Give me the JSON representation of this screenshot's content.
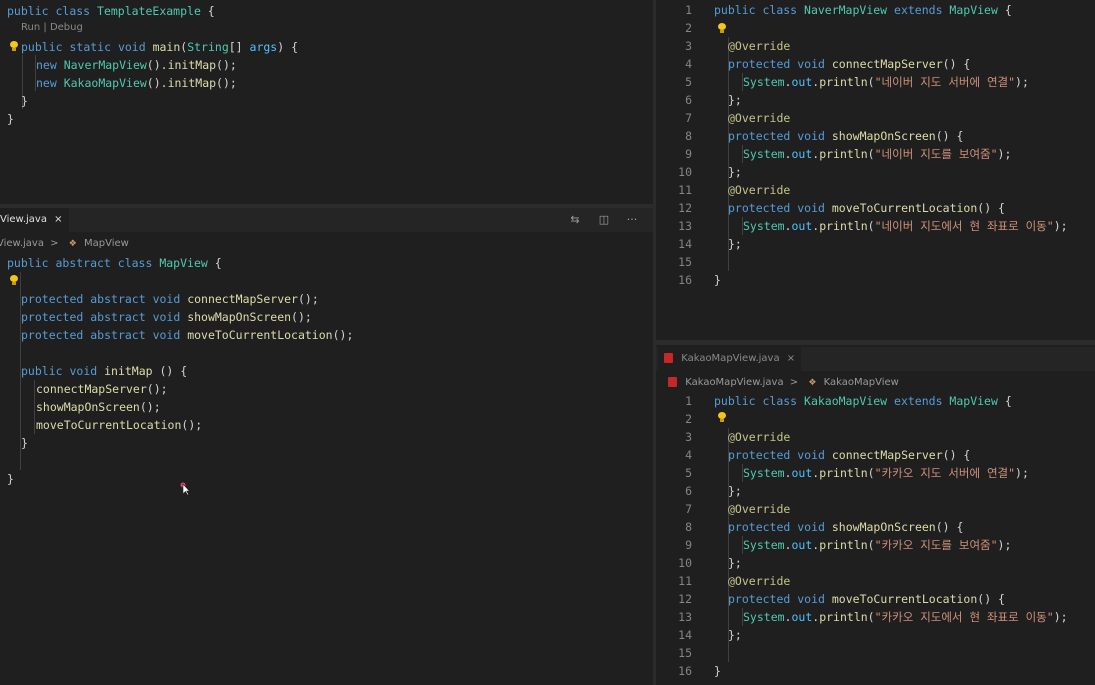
{
  "panes": {
    "top_left": {
      "codelens": {
        "run": "Run",
        "separator": "|",
        "debug": "Debug"
      },
      "lines": [
        [
          [
            "kw",
            "public "
          ],
          [
            "kw",
            "class "
          ],
          [
            "cls",
            "TemplateExample "
          ],
          [
            "plain",
            "{"
          ]
        ],
        [
          [
            "kw",
            "public "
          ],
          [
            "kw",
            "static "
          ],
          [
            "kw",
            "void "
          ],
          [
            "fn",
            "main"
          ],
          [
            "plain",
            "("
          ],
          [
            "cls",
            "String"
          ],
          [
            "plain",
            "[] "
          ],
          [
            "field",
            "args"
          ],
          [
            "plain",
            ") {"
          ]
        ],
        [
          [
            "kw",
            "new "
          ],
          [
            "cls",
            "NaverMapView"
          ],
          [
            "plain",
            "()."
          ],
          [
            "fn",
            "initMap"
          ],
          [
            "plain",
            "();"
          ]
        ],
        [
          [
            "kw",
            "new "
          ],
          [
            "cls",
            "KakaoMapView"
          ],
          [
            "plain",
            "()."
          ],
          [
            "fn",
            "initMap"
          ],
          [
            "plain",
            "();"
          ]
        ],
        [
          [
            "plain",
            "}"
          ]
        ],
        [
          [
            "plain",
            "}"
          ]
        ]
      ]
    },
    "bottom_left": {
      "tab": {
        "label": "View.java",
        "close": "×"
      },
      "breadcrumb": {
        "file": "View.java",
        "separator": ">",
        "symbol": "MapView"
      },
      "toolbar": {
        "compare": "⇆",
        "split": "◫",
        "more": "···"
      },
      "lines": [
        [
          [
            "kw",
            "public "
          ],
          [
            "kw",
            "abstract "
          ],
          [
            "kw",
            "class "
          ],
          [
            "cls",
            "MapView "
          ],
          [
            "plain",
            "{"
          ]
        ],
        [],
        [
          [
            "kw",
            "protected "
          ],
          [
            "kw",
            "abstract "
          ],
          [
            "kw",
            "void "
          ],
          [
            "fn",
            "connectMapServer"
          ],
          [
            "plain",
            "();"
          ]
        ],
        [
          [
            "kw",
            "protected "
          ],
          [
            "kw",
            "abstract "
          ],
          [
            "kw",
            "void "
          ],
          [
            "fn",
            "showMapOnScreen"
          ],
          [
            "plain",
            "();"
          ]
        ],
        [
          [
            "kw",
            "protected "
          ],
          [
            "kw",
            "abstract "
          ],
          [
            "kw",
            "void "
          ],
          [
            "fn",
            "moveToCurrentLocation"
          ],
          [
            "plain",
            "();"
          ]
        ],
        [],
        [
          [
            "kw",
            "public "
          ],
          [
            "kw",
            "void "
          ],
          [
            "fn",
            "initMap "
          ],
          [
            "plain",
            "() {"
          ]
        ],
        [
          [
            "fn",
            "connectMapServer"
          ],
          [
            "plain",
            "();"
          ]
        ],
        [
          [
            "fn",
            "showMapOnScreen"
          ],
          [
            "plain",
            "();"
          ]
        ],
        [
          [
            "fn",
            "moveToCurrentLocation"
          ],
          [
            "plain",
            "();"
          ]
        ],
        [
          [
            "plain",
            "}"
          ]
        ],
        [],
        [
          [
            "plain",
            "}"
          ]
        ]
      ]
    },
    "top_right": {
      "line_numbers": [
        "1",
        "2",
        "3",
        "4",
        "5",
        "6",
        "7",
        "8",
        "9",
        "10",
        "11",
        "12",
        "13",
        "14",
        "15",
        "16"
      ],
      "lines": [
        [
          [
            "kw",
            "public "
          ],
          [
            "kw",
            "class "
          ],
          [
            "cls",
            "NaverMapView "
          ],
          [
            "kw",
            "extends "
          ],
          [
            "cls",
            "MapView "
          ],
          [
            "plain",
            "{"
          ]
        ],
        [],
        [
          [
            "ann",
            "@Override"
          ]
        ],
        [
          [
            "kw",
            "protected "
          ],
          [
            "kw",
            "void "
          ],
          [
            "fn",
            "connectMapServer"
          ],
          [
            "plain",
            "() {"
          ]
        ],
        [
          [
            "cls",
            "System"
          ],
          [
            "plain",
            "."
          ],
          [
            "field",
            "out"
          ],
          [
            "plain",
            "."
          ],
          [
            "fn",
            "println"
          ],
          [
            "plain",
            "("
          ],
          [
            "str",
            "\"네이버 지도 서버에 연결\""
          ],
          [
            "plain",
            ");"
          ]
        ],
        [
          [
            "plain",
            "};"
          ]
        ],
        [
          [
            "ann",
            "@Override"
          ]
        ],
        [
          [
            "kw",
            "protected "
          ],
          [
            "kw",
            "void "
          ],
          [
            "fn",
            "showMapOnScreen"
          ],
          [
            "plain",
            "() {"
          ]
        ],
        [
          [
            "cls",
            "System"
          ],
          [
            "plain",
            "."
          ],
          [
            "field",
            "out"
          ],
          [
            "plain",
            "."
          ],
          [
            "fn",
            "println"
          ],
          [
            "plain",
            "("
          ],
          [
            "str",
            "\"네이버 지도를 보여줌\""
          ],
          [
            "plain",
            ");"
          ]
        ],
        [
          [
            "plain",
            "};"
          ]
        ],
        [
          [
            "ann",
            "@Override"
          ]
        ],
        [
          [
            "kw",
            "protected "
          ],
          [
            "kw",
            "void "
          ],
          [
            "fn",
            "moveToCurrentLocation"
          ],
          [
            "plain",
            "() {"
          ]
        ],
        [
          [
            "cls",
            "System"
          ],
          [
            "plain",
            "."
          ],
          [
            "field",
            "out"
          ],
          [
            "plain",
            "."
          ],
          [
            "fn",
            "println"
          ],
          [
            "plain",
            "("
          ],
          [
            "str",
            "\"네이버 지도에서 현 좌표로 이동\""
          ],
          [
            "plain",
            ");"
          ]
        ],
        [
          [
            "plain",
            "};"
          ]
        ],
        [],
        [
          [
            "plain",
            "}"
          ]
        ]
      ]
    },
    "bottom_right": {
      "tab": {
        "label": "KakaoMapView.java",
        "close": "×"
      },
      "breadcrumb": {
        "file": "KakaoMapView.java",
        "separator": ">",
        "symbol": "KakaoMapView"
      },
      "line_numbers": [
        "1",
        "2",
        "3",
        "4",
        "5",
        "6",
        "7",
        "8",
        "9",
        "10",
        "11",
        "12",
        "13",
        "14",
        "15",
        "16"
      ],
      "lines": [
        [
          [
            "kw",
            "public "
          ],
          [
            "kw",
            "class "
          ],
          [
            "cls",
            "KakaoMapView "
          ],
          [
            "kw",
            "extends "
          ],
          [
            "cls",
            "MapView "
          ],
          [
            "plain",
            "{"
          ]
        ],
        [],
        [
          [
            "ann",
            "@Override"
          ]
        ],
        [
          [
            "kw",
            "protected "
          ],
          [
            "kw",
            "void "
          ],
          [
            "fn",
            "connectMapServer"
          ],
          [
            "plain",
            "() {"
          ]
        ],
        [
          [
            "cls",
            "System"
          ],
          [
            "plain",
            "."
          ],
          [
            "field",
            "out"
          ],
          [
            "plain",
            "."
          ],
          [
            "fn",
            "println"
          ],
          [
            "plain",
            "("
          ],
          [
            "str",
            "\"카카오 지도 서버에 연결\""
          ],
          [
            "plain",
            ");"
          ]
        ],
        [
          [
            "plain",
            "};"
          ]
        ],
        [
          [
            "ann",
            "@Override"
          ]
        ],
        [
          [
            "kw",
            "protected "
          ],
          [
            "kw",
            "void "
          ],
          [
            "fn",
            "showMapOnScreen"
          ],
          [
            "plain",
            "() {"
          ]
        ],
        [
          [
            "cls",
            "System"
          ],
          [
            "plain",
            "."
          ],
          [
            "field",
            "out"
          ],
          [
            "plain",
            "."
          ],
          [
            "fn",
            "println"
          ],
          [
            "plain",
            "("
          ],
          [
            "str",
            "\"카카오 지도를 보여줌\""
          ],
          [
            "plain",
            ");"
          ]
        ],
        [
          [
            "plain",
            "};"
          ]
        ],
        [
          [
            "ann",
            "@Override"
          ]
        ],
        [
          [
            "kw",
            "protected "
          ],
          [
            "kw",
            "void "
          ],
          [
            "fn",
            "moveToCurrentLocation"
          ],
          [
            "plain",
            "() {"
          ]
        ],
        [
          [
            "cls",
            "System"
          ],
          [
            "plain",
            "."
          ],
          [
            "field",
            "out"
          ],
          [
            "plain",
            "."
          ],
          [
            "fn",
            "println"
          ],
          [
            "plain",
            "("
          ],
          [
            "str",
            "\"카카오 지도에서 현 좌표로 이동\""
          ],
          [
            "plain",
            ");"
          ]
        ],
        [
          [
            "plain",
            "};"
          ]
        ],
        [],
        [
          [
            "plain",
            "}"
          ]
        ]
      ]
    }
  },
  "colors": {
    "background": "#1f1f1f",
    "keyword": "#569cd6",
    "type": "#4ec9b0",
    "function": "#dcdcaa",
    "string": "#ce9178",
    "annotation": "#c4c48a",
    "line_number": "#858585",
    "lightbulb": "#f5c518"
  }
}
